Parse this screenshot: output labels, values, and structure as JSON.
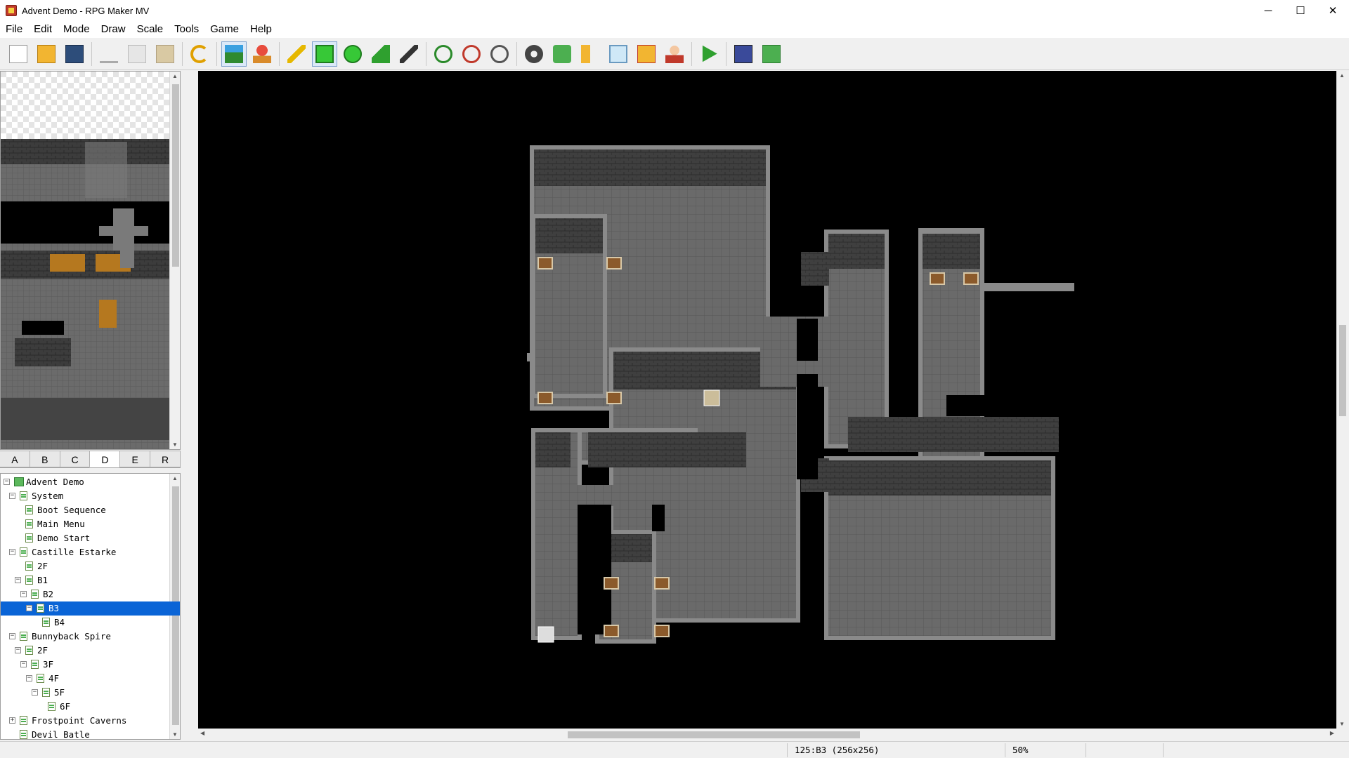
{
  "window": {
    "title": "Advent Demo - RPG Maker MV",
    "minimize": "─",
    "maximize": "☐",
    "close": "✕"
  },
  "menu": [
    "File",
    "Edit",
    "Mode",
    "Draw",
    "Scale",
    "Tools",
    "Game",
    "Help"
  ],
  "toolbar": {
    "buttons": [
      "new-project-icon",
      "open-project-icon",
      "save-project-icon",
      "sep",
      "cut-icon",
      "copy-icon",
      "paste-icon",
      "sep",
      "undo-icon",
      "sep",
      "map-mode-icon",
      "event-mode-icon",
      "sep",
      "pencil-icon",
      "rectangle-icon",
      "ellipse-icon",
      "fill-icon",
      "shadow-pen-icon",
      "sep",
      "zoom-in-icon",
      "zoom-out-icon",
      "actual-size-icon",
      "sep",
      "database-icon",
      "plugin-manager-icon",
      "sound-test-icon",
      "event-searcher-icon",
      "resource-manager-icon",
      "character-generator-icon",
      "sep",
      "playtest-icon",
      "sep",
      "open-folder-icon",
      "deploy-icon"
    ],
    "active": [
      "map-mode-icon",
      "rectangle-icon"
    ]
  },
  "tileset_tabs": [
    "A",
    "B",
    "C",
    "D",
    "E",
    "R"
  ],
  "tileset_active_tab": "D",
  "map_tree": [
    {
      "label": "Advent Demo",
      "level": 0,
      "toggle": "⊟",
      "root": true
    },
    {
      "label": "System",
      "level": 1,
      "toggle": "⊟"
    },
    {
      "label": "Boot Sequence",
      "level": 2
    },
    {
      "label": "Main Menu",
      "level": 2
    },
    {
      "label": "Demo Start",
      "level": 2
    },
    {
      "label": "Castille Estarke",
      "level": 1,
      "toggle": "⊟"
    },
    {
      "label": "2F",
      "level": 2
    },
    {
      "label": "B1",
      "level": 2,
      "toggle": "⊟"
    },
    {
      "label": "B2",
      "level": 3,
      "toggle": "⊟"
    },
    {
      "label": "B3",
      "level": 4,
      "toggle": "⊟",
      "selected": true
    },
    {
      "label": "B4",
      "level": 5
    },
    {
      "label": "Bunnyback Spire",
      "level": 1,
      "toggle": "⊟"
    },
    {
      "label": "2F",
      "level": 2,
      "toggle": "⊟"
    },
    {
      "label": "3F",
      "level": 3,
      "toggle": "⊟"
    },
    {
      "label": "4F",
      "level": 4,
      "toggle": "⊟"
    },
    {
      "label": "5F",
      "level": 5,
      "toggle": "⊟"
    },
    {
      "label": "6F",
      "level": 6
    },
    {
      "label": "Frostpoint Caverns",
      "level": 1,
      "toggle": "⊞"
    },
    {
      "label": "Devil Batle",
      "level": 1
    }
  ],
  "status": {
    "map_info": "125:B3 (256x256)",
    "zoom": "50%"
  },
  "colors": {
    "selection": "#0a64d6",
    "floor": "#6b6b6b",
    "wall": "#3e3e3e",
    "void": "#000000"
  }
}
